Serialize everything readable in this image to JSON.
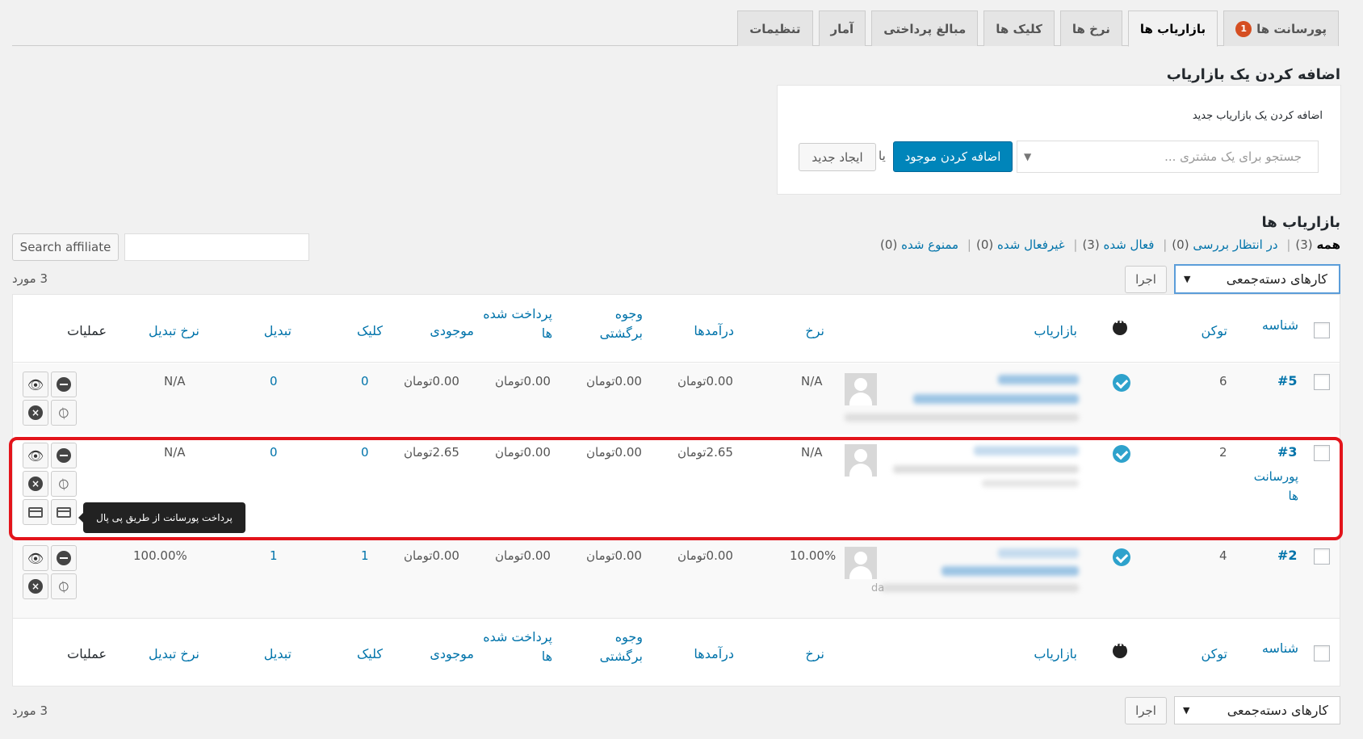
{
  "tabs": [
    {
      "label": "پورسانت ها",
      "badge": "1",
      "active": false
    },
    {
      "label": "بازاریاب ها",
      "active": true
    },
    {
      "label": "نرخ ها",
      "active": false
    },
    {
      "label": "کلیک ها",
      "active": false
    },
    {
      "label": "مبالغ پرداختی",
      "active": false
    },
    {
      "label": "آمار",
      "active": false
    },
    {
      "label": "تنظیمات",
      "active": false
    }
  ],
  "add_section": {
    "title": "اضافه کردن یک بازاریاب",
    "box_label": "اضافه کردن یک بازاریاب جدید",
    "customer_placeholder": "جستجو برای یک مشتری ...",
    "add_existing": "اضافه کردن موجود",
    "or": "یا",
    "create_new": "ایجاد جدید"
  },
  "list_section": {
    "title": "بازاریاب ها",
    "filters": [
      {
        "label": "همه",
        "count": "(3)",
        "current": true
      },
      {
        "label": "در انتظار بررسی",
        "count": "(0)"
      },
      {
        "label": "فعال شده",
        "count": "(3)"
      },
      {
        "label": "غیرفعال شده",
        "count": "(0)"
      },
      {
        "label": "ممنوع شده",
        "count": "(0)"
      }
    ],
    "search_button": "Search affiliate",
    "bulk_actions": "کارهای دسته‌جمعی",
    "apply": "اجرا",
    "items_count": "3 مورد"
  },
  "columns": {
    "id": "شناسه",
    "token": "توکن",
    "affiliate": "بازاریاب",
    "rate": "نرخ",
    "earnings": "درآمدها",
    "refunds_line1": "وجوه",
    "refunds_line2": "برگشتی",
    "paid_line1": "پرداخت شده",
    "paid_line2": "ها",
    "balance": "موجودی",
    "clicks": "کلیک",
    "conversions": "تبدیل",
    "conv_rate": "نرخ تبدیل",
    "actions": "عملیات"
  },
  "rows": [
    {
      "id": "#5",
      "token": "6",
      "rate": "N/A",
      "earnings": "0.00تومان",
      "refunds": "0.00تومان",
      "paid": "0.00تومان",
      "balance": "0.00تومان",
      "clicks": "0",
      "conversions": "0",
      "conv_rate": "N/A"
    },
    {
      "id": "#3",
      "id_sub_1": "پورسانت",
      "id_sub_2": "ها",
      "token": "2",
      "rate": "N/A",
      "earnings": "2.65تومان",
      "refunds": "0.00تومان",
      "paid": "0.00تومان",
      "balance": "2.65تومان",
      "clicks": "0",
      "conversions": "0",
      "conv_rate": "N/A"
    },
    {
      "id": "#2",
      "token": "4",
      "rate": "10.00%",
      "earnings": "0.00تومان",
      "refunds": "0.00تومان",
      "paid": "0.00تومان",
      "balance": "0.00تومان",
      "clicks": "1",
      "conversions": "1",
      "conv_rate": "100.00%",
      "avatar_fragment": "da"
    }
  ],
  "tooltip": "پرداخت پورسانت از طریق پی پال",
  "colors": {
    "accent": "#0073aa",
    "primary_button": "#0085ba",
    "highlight": "#e3141b",
    "badge": "#d54e21"
  }
}
